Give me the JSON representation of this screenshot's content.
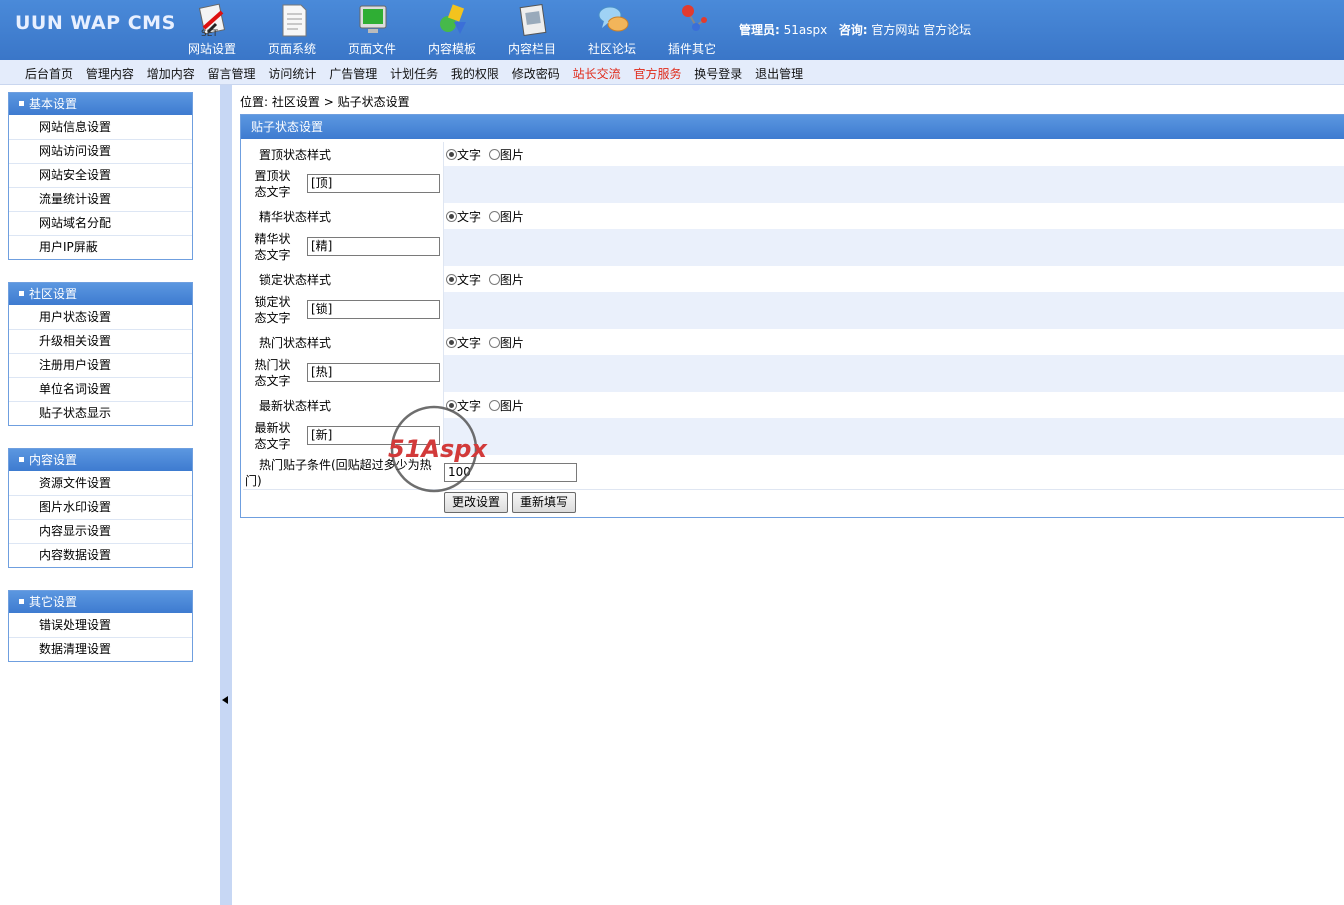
{
  "header": {
    "logo": "UUN WAP CMS",
    "nav": [
      {
        "label": "网站设置",
        "icon": "settings-icon"
      },
      {
        "label": "页面系统",
        "icon": "document-icon"
      },
      {
        "label": "页面文件",
        "icon": "monitor-icon"
      },
      {
        "label": "内容模板",
        "icon": "shapes-icon"
      },
      {
        "label": "内容栏目",
        "icon": "notepad-icon"
      },
      {
        "label": "社区论坛",
        "icon": "chat-icon"
      },
      {
        "label": "插件其它",
        "icon": "molecule-icon"
      }
    ],
    "admin_label": "管理员:",
    "admin_name": "51aspx",
    "consult_label": "咨询:",
    "link_site": "官方网站",
    "link_forum": "官方论坛"
  },
  "subnav": [
    {
      "label": "后台首页",
      "highlight": false
    },
    {
      "label": "管理内容",
      "highlight": false
    },
    {
      "label": "增加内容",
      "highlight": false
    },
    {
      "label": "留言管理",
      "highlight": false
    },
    {
      "label": "访问统计",
      "highlight": false
    },
    {
      "label": "广告管理",
      "highlight": false
    },
    {
      "label": "计划任务",
      "highlight": false
    },
    {
      "label": "我的权限",
      "highlight": false
    },
    {
      "label": "修改密码",
      "highlight": false
    },
    {
      "label": "站长交流",
      "highlight": true
    },
    {
      "label": "官方服务",
      "highlight": true
    },
    {
      "label": "换号登录",
      "highlight": false
    },
    {
      "label": "退出管理",
      "highlight": false
    }
  ],
  "sidebar": {
    "groups": [
      {
        "title": "基本设置",
        "items": [
          "网站信息设置",
          "网站访问设置",
          "网站安全设置",
          "流量统计设置",
          "网站域名分配",
          "用户IP屏蔽"
        ]
      },
      {
        "title": "社区设置",
        "items": [
          "用户状态设置",
          "升级相关设置",
          "注册用户设置",
          "单位名词设置",
          "贴子状态显示"
        ]
      },
      {
        "title": "内容设置",
        "items": [
          "资源文件设置",
          "图片水印设置",
          "内容显示设置",
          "内容数据设置"
        ]
      },
      {
        "title": "其它设置",
        "items": [
          "错误处理设置",
          "数据清理设置"
        ]
      }
    ]
  },
  "breadcrumb": {
    "label": "位置:",
    "path1": "社区设置",
    "sep": ">",
    "path2": "贴子状态设置"
  },
  "panel": {
    "title": "贴子状态设置",
    "radio_text": "文字",
    "radio_image": "图片",
    "rows": {
      "top_style": "置顶状态样式",
      "top_text_l1": "置顶状",
      "top_text_l2": "态文字",
      "top_value": "[顶]",
      "ess_style": "精华状态样式",
      "ess_text_l1": "精华状",
      "ess_text_l2": "态文字",
      "ess_value": "[精]",
      "lock_style": "锁定状态样式",
      "lock_text_l1": "锁定状",
      "lock_text_l2": "态文字",
      "lock_value": "[锁]",
      "hot_style": "热门状态样式",
      "hot_text_l1": "热门状",
      "hot_text_l2": "态文字",
      "hot_value": "[热]",
      "new_style": "最新状态样式",
      "new_text_l1": "最新状",
      "new_text_l2": "态文字",
      "new_value": "[新]",
      "hot_cond_l1": "热门贴子条件(回贴超过多少为热",
      "hot_cond_l2": "门)",
      "hot_cond_value": "100"
    },
    "submit_label": "更改设置",
    "reset_label": "重新填写"
  },
  "watermark": {
    "text": "51Aspx"
  },
  "colors": {
    "header_blue": "#3f7dcc",
    "subnav_bg": "#e4ecfb",
    "accent_red": "#e02a1a",
    "row_alt": "#eaf0fb"
  }
}
